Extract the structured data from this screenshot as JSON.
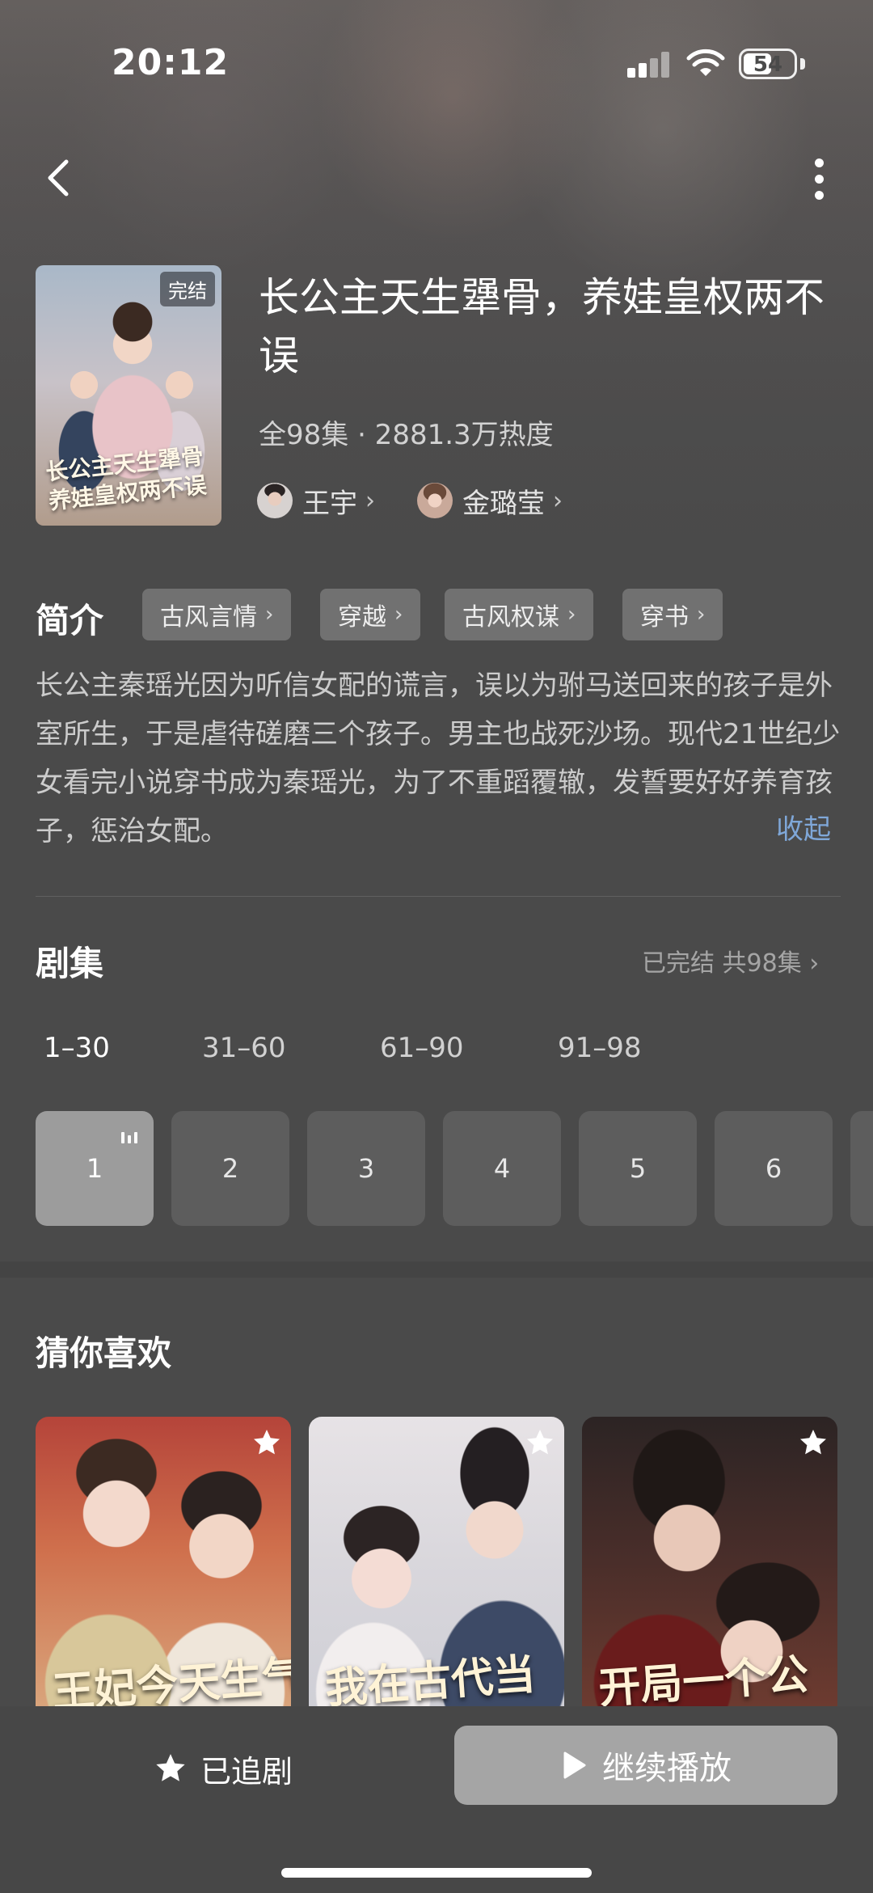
{
  "status_bar": {
    "time": "20:12",
    "battery": "54"
  },
  "drama": {
    "cover_badge": "完结",
    "cover_art_text": "长公主天生犟骨 养娃皇权两不误",
    "title": "长公主天生犟骨，养娃皇权两不误",
    "meta": "全98集 · 2881.3万热度",
    "cast": [
      {
        "name": "王宇"
      },
      {
        "name": "金璐莹"
      }
    ]
  },
  "intro": {
    "label": "简介",
    "tags": [
      "古风言情",
      "穿越",
      "古风权谋",
      "穿书"
    ],
    "synopsis": "长公主秦瑶光因为听信女配的谎言，误以为驸马送回来的孩子是外室所生，于是虐待磋磨三个孩子。男主也战死沙场。现代21世纪少女看完小说穿书成为秦瑶光，为了不重蹈覆辙，发誓要好好养育孩子，惩治女配。",
    "collapse_label": "收起"
  },
  "episodes": {
    "title": "剧集",
    "status": "已完结 共98集",
    "ranges": [
      "1–30",
      "31–60",
      "61–90",
      "91–98"
    ],
    "active_range": 0,
    "items": [
      "1",
      "2",
      "3",
      "4",
      "5",
      "6"
    ],
    "playing": "1"
  },
  "recommendations": {
    "title": "猜你喜欢",
    "items": [
      {
        "poster_text": "王妃今天生气了吗"
      },
      {
        "poster_text": "我在古代当"
      },
      {
        "poster_text": "开局一个公"
      }
    ]
  },
  "actions": {
    "follow_label": "已追剧",
    "play_label": "继续播放"
  },
  "icons": {
    "back": "chevron-left-icon",
    "more": "more-vertical-icon",
    "star": "star-icon",
    "play": "play-icon"
  },
  "colors": {
    "background": "#4a4a4a",
    "accent_link": "#7fa7d8",
    "active_episode": "#9c9c9c",
    "play_button": "#a5a5a5"
  }
}
